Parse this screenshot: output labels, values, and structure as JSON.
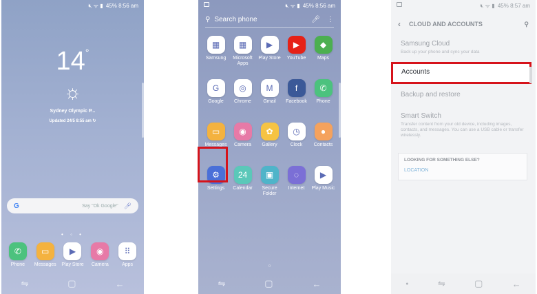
{
  "home": {
    "status": {
      "signal_icon": "mute-wifi-signal-icon",
      "battery": "45%",
      "time": "8:56 am"
    },
    "clock": {
      "temp": "14",
      "degree": "°"
    },
    "weather": {
      "location": "Sydney Olympic P...",
      "updated": "Updated 24/5 8:55 am"
    },
    "google": {
      "letter": "G",
      "hint": "Say \"Ok Google\""
    },
    "dock": [
      {
        "label": "Phone",
        "icon": "phone-icon",
        "glyph": "✆",
        "color": "#4cc27e"
      },
      {
        "label": "Messages",
        "icon": "messages-icon",
        "glyph": "▭",
        "color": "#f4b23f"
      },
      {
        "label": "Play Store",
        "icon": "play-store-icon",
        "glyph": "▶",
        "color": "#ffffff"
      },
      {
        "label": "Camera",
        "icon": "camera-icon",
        "glyph": "◉",
        "color": "#e77aa7"
      },
      {
        "label": "Apps",
        "icon": "apps-grid-icon",
        "glyph": "⠿",
        "color": "#ffffff"
      }
    ]
  },
  "drawer": {
    "status": {
      "battery": "45%",
      "time": "8:56 am"
    },
    "search": {
      "placeholder": "Search phone"
    },
    "apps": [
      {
        "label": "Samsung",
        "icon": "samsung-folder-icon",
        "glyph": "▦",
        "color": "#ffffff"
      },
      {
        "label": "Microsoft Apps",
        "icon": "microsoft-folder-icon",
        "glyph": "▦",
        "color": "#ffffff"
      },
      {
        "label": "Play Store",
        "icon": "play-store-icon",
        "glyph": "▶",
        "color": "#ffffff"
      },
      {
        "label": "YouTube",
        "icon": "youtube-icon",
        "glyph": "▶",
        "color": "#e62117"
      },
      {
        "label": "Maps",
        "icon": "maps-icon",
        "glyph": "◆",
        "color": "#4caf50"
      },
      {
        "label": "Google",
        "icon": "google-icon",
        "glyph": "G",
        "color": "#ffffff"
      },
      {
        "label": "Chrome",
        "icon": "chrome-icon",
        "glyph": "◎",
        "color": "#ffffff"
      },
      {
        "label": "Gmail",
        "icon": "gmail-icon",
        "glyph": "M",
        "color": "#ffffff"
      },
      {
        "label": "Facebook",
        "icon": "facebook-icon",
        "glyph": "f",
        "color": "#3b5998"
      },
      {
        "label": "Phone",
        "icon": "phone-icon",
        "glyph": "✆",
        "color": "#4cc27e"
      },
      {
        "label": "Messages",
        "icon": "messages-icon",
        "glyph": "▭",
        "color": "#f4b23f"
      },
      {
        "label": "Camera",
        "icon": "camera-icon",
        "glyph": "◉",
        "color": "#e77aa7"
      },
      {
        "label": "Gallery",
        "icon": "gallery-icon",
        "glyph": "✿",
        "color": "#f6c343"
      },
      {
        "label": "Clock",
        "icon": "clock-icon",
        "glyph": "◷",
        "color": "#ffffff"
      },
      {
        "label": "Contacts",
        "icon": "contacts-icon",
        "glyph": "●",
        "color": "#f5a25d"
      },
      {
        "label": "Settings",
        "icon": "settings-gear-icon",
        "glyph": "⚙",
        "color": "#4a6fd8"
      },
      {
        "label": "Calendar",
        "icon": "calendar-icon",
        "glyph": "24",
        "color": "#5bc8b9"
      },
      {
        "label": "Secure Folder",
        "icon": "secure-folder-icon",
        "glyph": "▣",
        "color": "#4fb4c9"
      },
      {
        "label": "Internet",
        "icon": "internet-icon",
        "glyph": "◌",
        "color": "#7b6fd6"
      },
      {
        "label": "Play Music",
        "icon": "play-music-icon",
        "glyph": "▶",
        "color": "#ffffff"
      }
    ]
  },
  "settings": {
    "status": {
      "battery": "45%",
      "time": "8:57 am"
    },
    "title": "CLOUD AND ACCOUNTS",
    "items": [
      {
        "title": "Samsung Cloud",
        "sub": "Back up your phone and sync your data"
      },
      {
        "title": "Accounts",
        "sub": ""
      },
      {
        "title": "Backup and restore",
        "sub": ""
      },
      {
        "title": "Smart Switch",
        "sub": "Transfer content from your old device, including images, contacts, and messages. You can use a USB cable or transfer wirelessly."
      }
    ],
    "looking": {
      "title": "LOOKING FOR SOMETHING ELSE?",
      "link": "LOCATION"
    }
  }
}
